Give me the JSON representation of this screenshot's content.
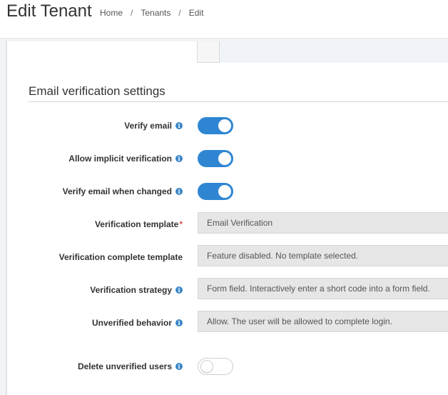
{
  "header": {
    "title": "Edit Tenant",
    "breadcrumb": [
      "Home",
      "Tenants",
      "Edit"
    ],
    "separator": "/"
  },
  "section": {
    "title": "Email verification settings"
  },
  "rows": {
    "verify_email": {
      "label": "Verify email",
      "enabled": true
    },
    "allow_implicit": {
      "label": "Allow implicit verification",
      "enabled": true
    },
    "verify_on_change": {
      "label": "Verify email when changed",
      "enabled": true
    },
    "verification_template": {
      "label": "Verification template",
      "required_mark": "*",
      "value": "Email Verification"
    },
    "complete_template": {
      "label": "Verification complete template",
      "value": "Feature disabled. No template selected."
    },
    "strategy": {
      "label": "Verification strategy",
      "value": "Form field. Interactively enter a short code into a form field."
    },
    "unverified_behavior": {
      "label": "Unverified behavior",
      "value": "Allow. The user will be allowed to complete login."
    },
    "delete_unverified": {
      "label": "Delete unverified users",
      "enabled": false
    }
  },
  "info_icon_glyph": "i",
  "colors": {
    "toggle_on": "#2e86d3",
    "info_icon": "#3a86c8",
    "required": "#d9534f"
  }
}
